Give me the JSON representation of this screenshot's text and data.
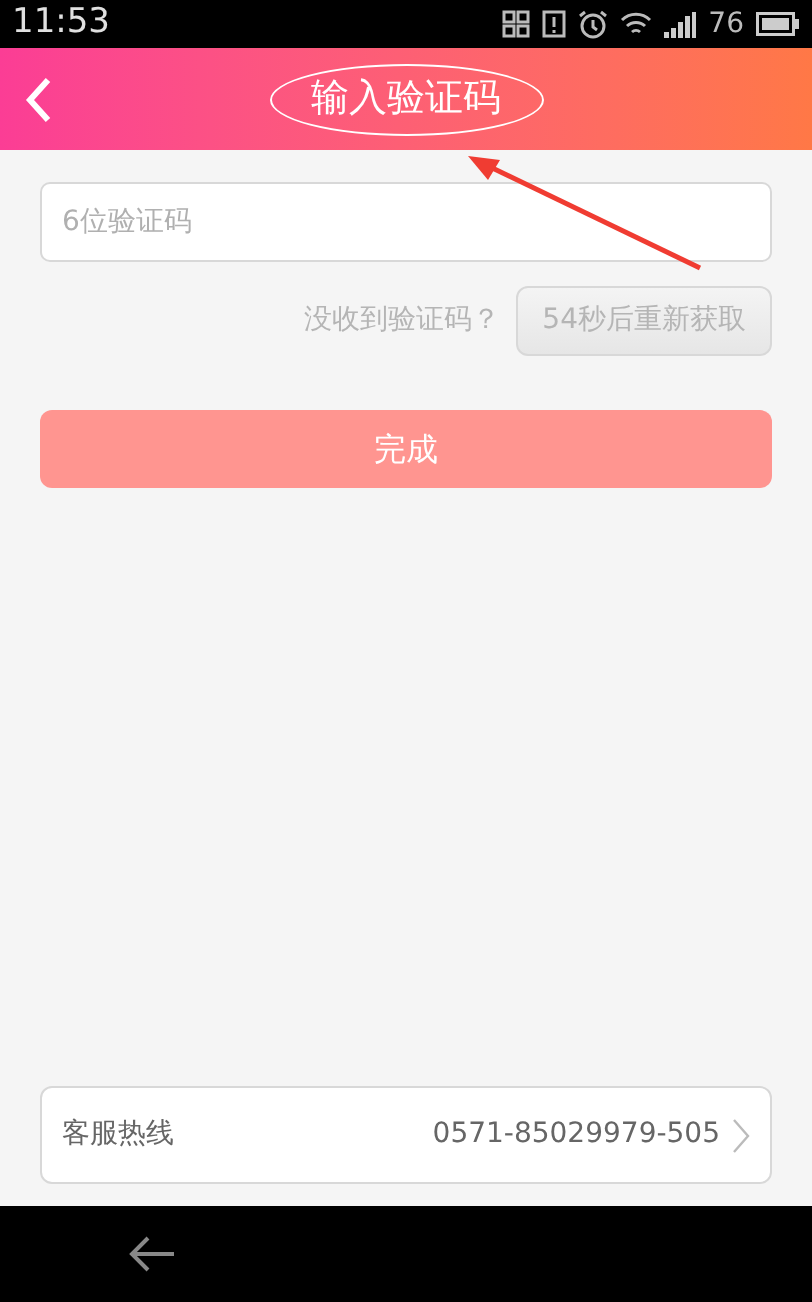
{
  "status_bar": {
    "time": "11:53",
    "battery": "76"
  },
  "header": {
    "title": "输入验证码"
  },
  "code_field": {
    "placeholder": "6位验证码"
  },
  "resend": {
    "prompt": "没收到验证码？",
    "button": "54秒后重新获取",
    "disabled": true
  },
  "done_button": "完成",
  "hotline": {
    "label": "客服热线",
    "number": "0571-85029979-505"
  }
}
